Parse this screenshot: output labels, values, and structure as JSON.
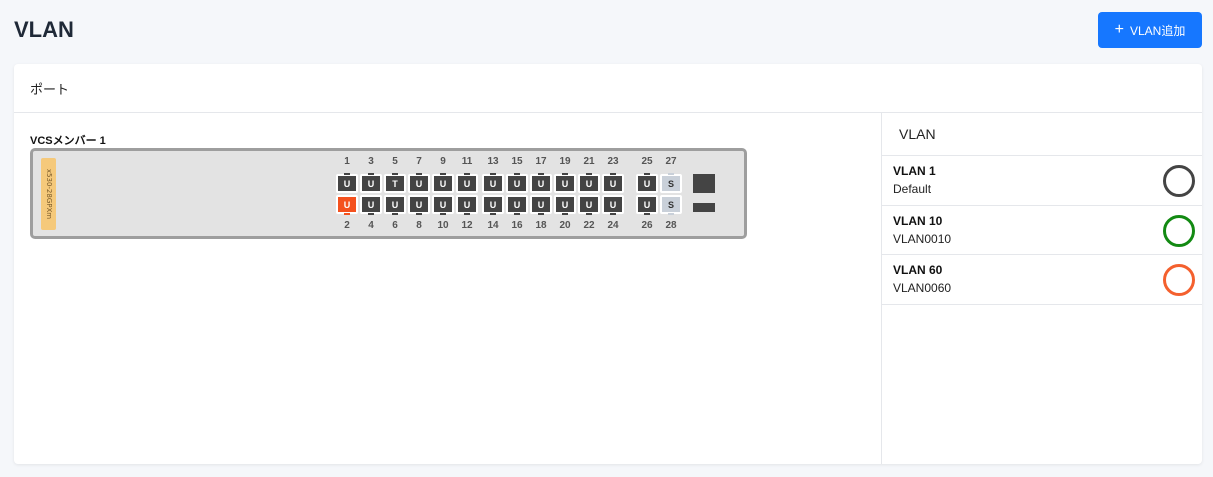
{
  "header": {
    "title": "VLAN",
    "add_button_label": "VLAN追加",
    "add_button_icon": "plus-icon"
  },
  "card": {
    "title": "ポート"
  },
  "switch": {
    "member_label": "VCSメンバー 1",
    "model": "x530-28GPXm",
    "top_ports": [
      {
        "num": "1",
        "mode": "U"
      },
      {
        "num": "3",
        "mode": "U"
      },
      {
        "num": "5",
        "mode": "T"
      },
      {
        "num": "7",
        "mode": "U"
      },
      {
        "num": "9",
        "mode": "U"
      },
      {
        "num": "11",
        "mode": "U"
      },
      {
        "num": "13",
        "mode": "U"
      },
      {
        "num": "15",
        "mode": "U"
      },
      {
        "num": "17",
        "mode": "U"
      },
      {
        "num": "19",
        "mode": "U"
      },
      {
        "num": "21",
        "mode": "U"
      },
      {
        "num": "23",
        "mode": "U"
      },
      {
        "num": "25",
        "mode": "U"
      },
      {
        "num": "27",
        "mode": "S"
      }
    ],
    "bottom_ports": [
      {
        "num": "2",
        "mode": "U",
        "active": true
      },
      {
        "num": "4",
        "mode": "U"
      },
      {
        "num": "6",
        "mode": "U"
      },
      {
        "num": "8",
        "mode": "U"
      },
      {
        "num": "10",
        "mode": "U"
      },
      {
        "num": "12",
        "mode": "U"
      },
      {
        "num": "14",
        "mode": "U"
      },
      {
        "num": "16",
        "mode": "U"
      },
      {
        "num": "18",
        "mode": "U"
      },
      {
        "num": "20",
        "mode": "U"
      },
      {
        "num": "22",
        "mode": "U"
      },
      {
        "num": "24",
        "mode": "U"
      },
      {
        "num": "26",
        "mode": "U"
      },
      {
        "num": "28",
        "mode": "S"
      }
    ]
  },
  "vlan_panel": {
    "title": "VLAN",
    "items": [
      {
        "name": "VLAN 1",
        "desc": "Default",
        "color": "#444444"
      },
      {
        "name": "VLAN 10",
        "desc": "VLAN0010",
        "color": "#138a13"
      },
      {
        "name": "VLAN 60",
        "desc": "VLAN0060",
        "color": "#f4602e"
      }
    ]
  },
  "colors": {
    "accent": "#1677ff",
    "active_port": "#f4511e",
    "port": "#444444",
    "sfp_port": "#c9d0d9"
  }
}
